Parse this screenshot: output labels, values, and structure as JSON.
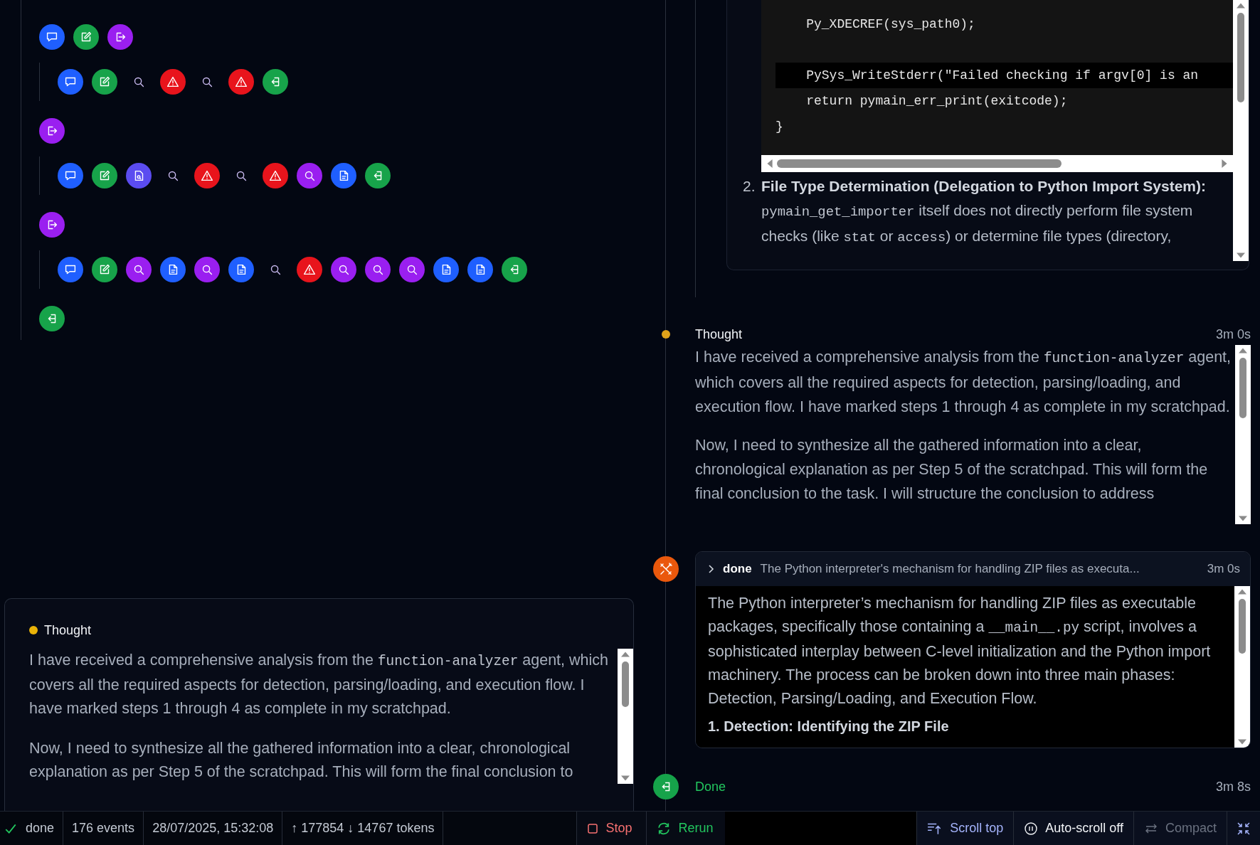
{
  "timeline": [
    {
      "icons": [
        {
          "kind": "chat"
        },
        {
          "kind": "edit"
        },
        {
          "kind": "exit"
        }
      ],
      "children": [
        {
          "icons": [
            {
              "kind": "chat"
            },
            {
              "kind": "edit"
            },
            {
              "kind": "search-plain"
            },
            {
              "kind": "warning"
            },
            {
              "kind": "search-plain"
            },
            {
              "kind": "warning"
            },
            {
              "kind": "enter"
            }
          ]
        }
      ]
    },
    {
      "icons": [
        {
          "kind": "exit"
        }
      ],
      "children": [
        {
          "icons": [
            {
              "kind": "chat"
            },
            {
              "kind": "edit"
            },
            {
              "kind": "doc-search"
            },
            {
              "kind": "search-plain"
            },
            {
              "kind": "warning"
            },
            {
              "kind": "search-plain"
            },
            {
              "kind": "warning"
            },
            {
              "kind": "search"
            },
            {
              "kind": "doc"
            },
            {
              "kind": "enter"
            }
          ]
        }
      ]
    },
    {
      "icons": [
        {
          "kind": "exit"
        }
      ],
      "children": [
        {
          "icons": [
            {
              "kind": "chat"
            },
            {
              "kind": "edit"
            },
            {
              "kind": "search"
            },
            {
              "kind": "doc"
            },
            {
              "kind": "search"
            },
            {
              "kind": "doc"
            },
            {
              "kind": "search-plain"
            },
            {
              "kind": "warning"
            },
            {
              "kind": "search"
            },
            {
              "kind": "search"
            },
            {
              "kind": "search"
            },
            {
              "kind": "doc"
            },
            {
              "kind": "doc"
            },
            {
              "kind": "enter"
            }
          ]
        }
      ]
    },
    {
      "icons": [
        {
          "kind": "enter"
        }
      ]
    }
  ],
  "preview": {
    "title": "Thought",
    "paragraphs": [
      [
        {
          "t": "I have received a comprehensive analysis from the "
        },
        {
          "t": "function-analyzer",
          "code": true
        },
        {
          "t": " agent, which covers all the required aspects for detection, parsing/loading, and execution flow. I have marked steps 1 through 4 as complete in my scratchpad."
        }
      ],
      [
        {
          "t": "Now, I need to synthesize all the gathered information into a clear, chronological explanation as per Step 5 of the scratchpad. This will form the final conclusion to"
        }
      ]
    ]
  },
  "code_card": {
    "lines": [
      {
        "text": "    Py_XDECREF(sys_path0);",
        "blank_before": false
      },
      {
        "text": "    PySys_WriteStderr(\"Failed checking if argv[0] is an",
        "blank_before": true
      },
      {
        "text": "    return pymain_err_print(exitcode);",
        "blank_before": false
      },
      {
        "text": "}",
        "blank_before": false
      }
    ],
    "item": {
      "number": "2.",
      "title": "File Type Determination (Delegation to Python Import System):",
      "body": [
        {
          "t": "pymain_get_importer",
          "code": true
        },
        {
          "t": " itself does not directly perform file system checks (like "
        },
        {
          "t": "stat",
          "code": true
        },
        {
          "t": " or "
        },
        {
          "t": "access",
          "code": true
        },
        {
          "t": ") or determine file types (directory,"
        }
      ]
    }
  },
  "thought": {
    "title": "Thought",
    "time": "3m 0s",
    "paragraphs": [
      [
        {
          "t": "I have received a comprehensive analysis from the "
        },
        {
          "t": "function-analyzer",
          "code": true
        },
        {
          "t": " agent, which covers all the required aspects for detection, parsing/loading, and execution flow. I have marked steps 1 through 4 as complete in my scratchpad."
        }
      ],
      [
        {
          "t": "Now, I need to synthesize all the gathered information into a clear, chronological explanation as per Step 5 of the scratchpad. This will form the final conclusion to the task. I will structure the conclusion to address"
        }
      ]
    ]
  },
  "tool_call": {
    "name": "done",
    "summary": "The Python interpreter's mechanism for handling ZIP files as executa...",
    "time": "3m 0s",
    "body": [
      {
        "t": "The Python interpreter’s mechanism for handling ZIP files as executable packages, specifically those containing a "
      },
      {
        "t": "__main__.py",
        "code": true
      },
      {
        "t": " script, involves a sophisticated interplay between C-level initialization and the Python import machinery. The process can be broken down into three main phases: Detection, Parsing/Loading, and Execution Flow."
      }
    ],
    "heading": "1. Detection: Identifying the ZIP File"
  },
  "done": {
    "label": "Done",
    "time": "3m 8s"
  },
  "status_bar": {
    "state": "done",
    "events": "176 events",
    "started": "28/07/2025, 15:32:08",
    "tokens": "↑ 177854 ↓ 14767 tokens",
    "left_buttons": [
      {
        "kind": "stop",
        "label": "Stop"
      },
      {
        "kind": "rerun",
        "label": "Rerun"
      }
    ],
    "right_buttons": [
      {
        "kind": "scroll-top",
        "label": "Scroll top",
        "disabled": false
      },
      {
        "kind": "autoscroll",
        "label": "Auto-scroll off",
        "disabled": false
      },
      {
        "kind": "compact",
        "label": "Compact",
        "disabled": true
      },
      {
        "kind": "collapse",
        "disabled": false
      }
    ]
  }
}
